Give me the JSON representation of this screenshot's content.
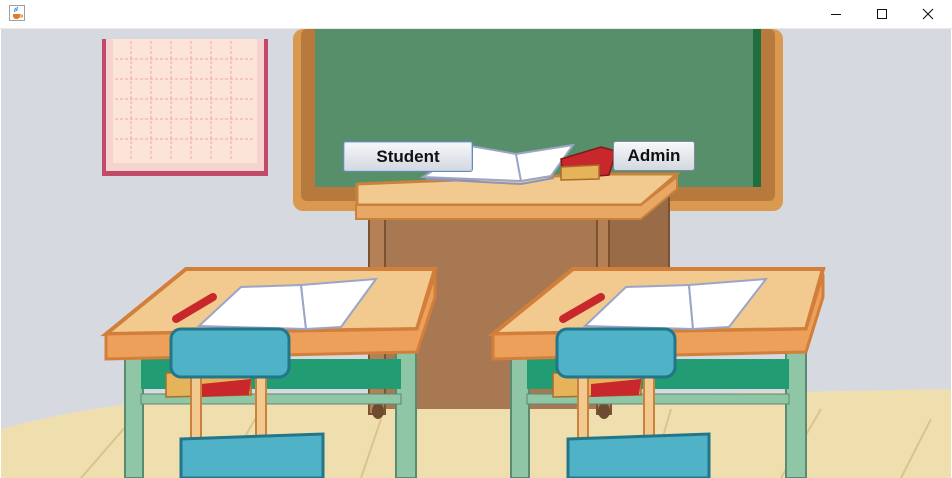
{
  "window": {
    "title": "",
    "icon": "java-cup-icon",
    "controls": [
      "minimize-icon",
      "maximize-icon",
      "close-icon"
    ]
  },
  "buttons": {
    "student_label": "Student",
    "admin_label": "Admin"
  },
  "background": {
    "description_icon": "classroom-illustration",
    "colors": {
      "wall": "#d7d9e0",
      "chalkboard": "#578f6a",
      "frame": "#d9994f",
      "desk_top": "#f2c98e",
      "seat": "#4fb2c6",
      "floor": "#f0dfae"
    }
  }
}
